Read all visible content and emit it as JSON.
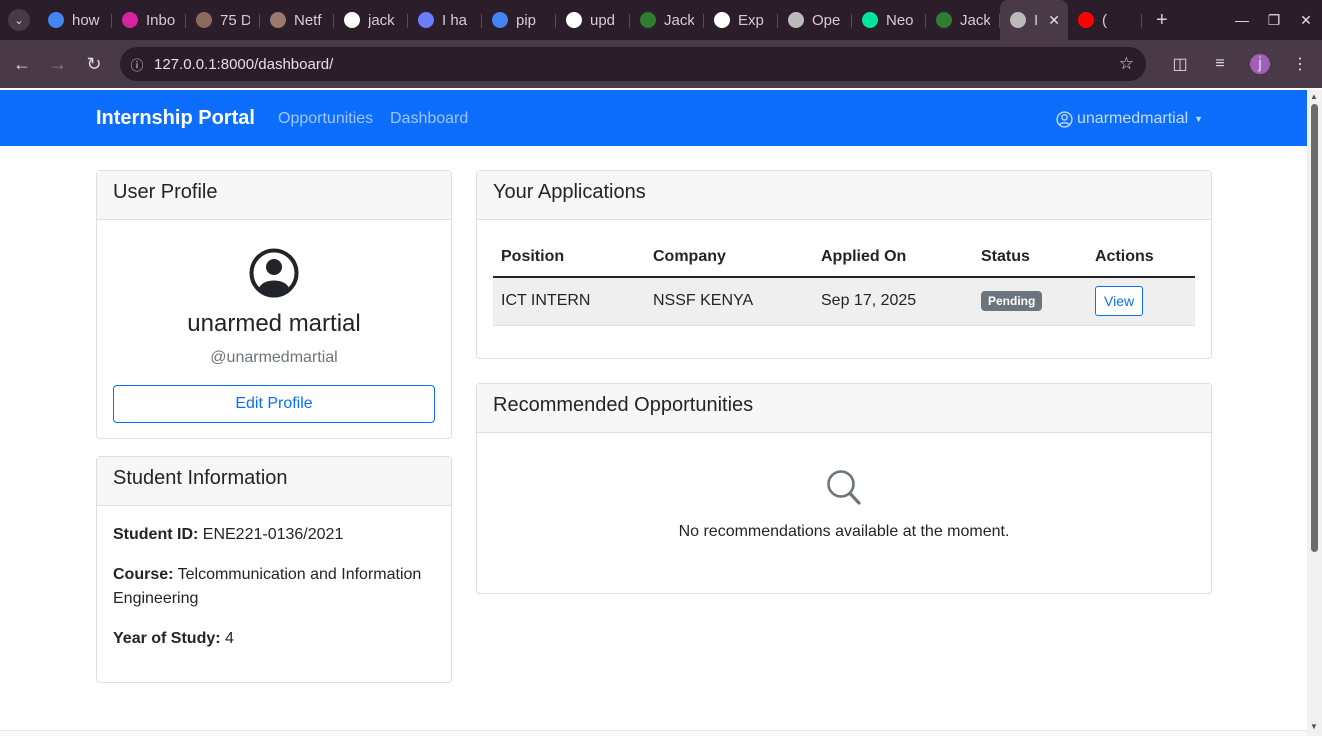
{
  "browser": {
    "tabs": [
      {
        "title": "how",
        "favicon": "google-icon",
        "color": "#4285f4"
      },
      {
        "title": "Inbo",
        "favicon": "instagram-icon",
        "color": "#d6249f"
      },
      {
        "title": "75 D",
        "favicon": "avatar-icon",
        "color": "#8b6a5e"
      },
      {
        "title": "Netf",
        "favicon": "avatar-icon",
        "color": "#9b7a6e"
      },
      {
        "title": "jack",
        "favicon": "hub-icon",
        "color": "#ffffff"
      },
      {
        "title": "I ha",
        "favicon": "vercel-icon",
        "color": "#6b7cff"
      },
      {
        "title": "pip",
        "favicon": "google-icon",
        "color": "#4285f4"
      },
      {
        "title": "upd",
        "favicon": "github-icon",
        "color": "#ffffff"
      },
      {
        "title": "Jack",
        "favicon": "flag-icon",
        "color": "#2e7d32"
      },
      {
        "title": "Exp",
        "favicon": "openai-icon",
        "color": "#ffffff"
      },
      {
        "title": "Ope",
        "favicon": "globe-icon",
        "color": "#bbbbbb"
      },
      {
        "title": "Neo",
        "favicon": "neon-icon",
        "color": "#00e599"
      },
      {
        "title": "Jack",
        "favicon": "flag-icon",
        "color": "#2e7d32"
      },
      {
        "title": "I",
        "favicon": "globe-icon",
        "color": "#bbbbbb",
        "active": true
      },
      {
        "title": "(",
        "favicon": "youtube-icon",
        "color": "#ff0000"
      }
    ],
    "url": "127.0.0.1:8000/dashboard/",
    "profile_initial": "j"
  },
  "nav": {
    "brand": "Internship Portal",
    "links": [
      "Opportunities",
      "Dashboard"
    ],
    "user": "unarmedmartial"
  },
  "profile": {
    "header": "User Profile",
    "name": "unarmed martial",
    "handle": "@unarmedmartial",
    "edit_label": "Edit Profile"
  },
  "student": {
    "header": "Student Information",
    "id_label": "Student ID:",
    "id_value": "ENE221-0136/2021",
    "course_label": "Course:",
    "course_value": "Telcommunication and Information Engineering",
    "year_label": "Year of Study:",
    "year_value": "4"
  },
  "applications": {
    "header": "Your Applications",
    "columns": [
      "Position",
      "Company",
      "Applied On",
      "Status",
      "Actions"
    ],
    "rows": [
      {
        "position": "ICT INTERN",
        "company": "NSSF KENYA",
        "applied_on": "Sep 17, 2025",
        "status": "Pending",
        "action": "View"
      }
    ]
  },
  "recommended": {
    "header": "Recommended Opportunities",
    "empty_text": "No recommendations available at the moment."
  },
  "colors": {
    "primary": "#0d6efd",
    "badge": "#6c757d",
    "chrome_dark": "#2b1d29",
    "chrome_mid": "#4a3a47"
  }
}
